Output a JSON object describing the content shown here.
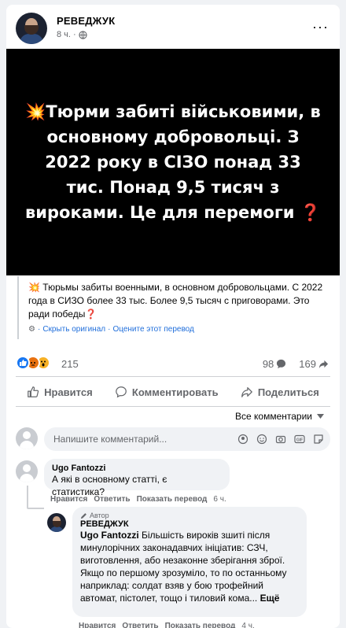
{
  "post": {
    "author": "РЕВЕДЖУК",
    "time": "8 ч.",
    "more_label": "···",
    "image_emoji": "💥",
    "image_text": "Тюрми забиті військовими, в основному добровольці. З 2022 року в СІЗО понад 33 тис. Понад 9,5 тисяч з вироками. Це для перемоги",
    "image_end_emoji": "❓",
    "translation_emoji": "💥",
    "translation": "Тюрьмы забиты военными, в основном добровольцами. С 2022 года в СИЗО более 33 тыс. Более 9,5 тысяч с приговорами. Это ради победы",
    "translation_end_emoji": "❓",
    "show_original": "Скрыть оригинал",
    "rate_translation": "Оцените этот перевод",
    "separator": "·"
  },
  "reactions": {
    "count": "215",
    "comments": "98",
    "shares": "169"
  },
  "actions": {
    "like": "Нравится",
    "comment": "Комментировать",
    "share": "Поделиться"
  },
  "comments_sort": "Все комментарии",
  "comment_input": {
    "placeholder": "Напишите комментарий..."
  },
  "comment1": {
    "name": "Ugo Fantozzi",
    "text": "А які в основному статті, є статистика?",
    "like": "Нравится",
    "reply": "Ответить",
    "translate": "Показать перевод",
    "time": "6 ч."
  },
  "reply1": {
    "badge": "Автор",
    "name": "РЕВЕДЖУК",
    "mention": "Ugo Fantozzi",
    "text": "Більшість вироків зшиті після минулорічних законадавчих ініціатив: СЗЧ, виготовлення, або незаконне зберігання зброї. Якщо по першому зрозуміло, то по останньому наприклад: солдат взяв у бою трофейний автомат, пістолет, тощо і тиловий кома...",
    "see_more": "Ещё",
    "like": "Нравится",
    "reply": "Ответить",
    "translate": "Показать перевод",
    "time": "4 ч."
  }
}
